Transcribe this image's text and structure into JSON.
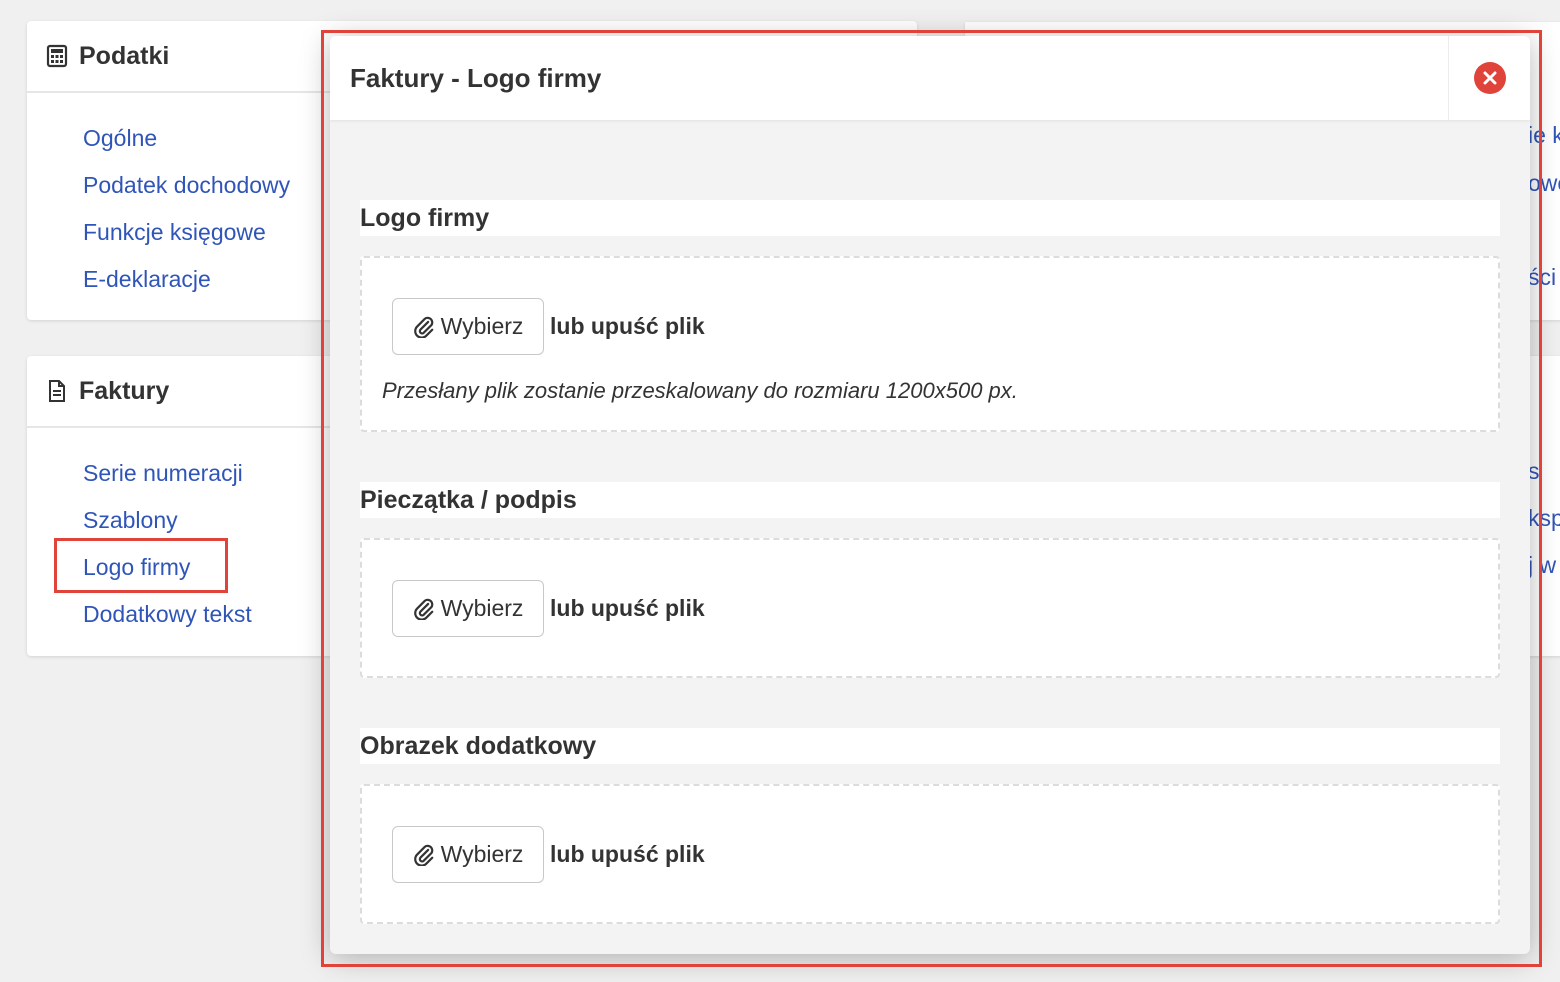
{
  "sidebar": {
    "podatki": {
      "title": "Podatki",
      "icon": "calculator-icon",
      "items": [
        "Ogólne",
        "Podatek dochodowy",
        "Funkcje księgowe",
        "E-deklaracje"
      ]
    },
    "faktury": {
      "title": "Faktury",
      "icon": "document-icon",
      "items": [
        "Serie numeracji",
        "Szablony",
        "Logo firmy",
        "Dodatkowy tekst"
      ]
    }
  },
  "right_fragments": [
    "ie k",
    "owe",
    "ści",
    "s",
    "ksp",
    "j w"
  ],
  "modal": {
    "title": "Faktury - Logo firmy",
    "close_icon": "close-circle-icon",
    "sections": [
      {
        "title": "Logo firmy",
        "choose_label": "Wybierz",
        "drop_text": "lub upuść plik",
        "hint": "Przesłany plik zostanie przeskalowany do rozmiaru 1200x500 px."
      },
      {
        "title": "Pieczątka / podpis",
        "choose_label": "Wybierz",
        "drop_text": "lub upuść plik"
      },
      {
        "title": "Obrazek dodatkowy",
        "choose_label": "Wybierz",
        "drop_text": "lub upuść plik"
      }
    ]
  },
  "colors": {
    "link": "#2f55b8",
    "highlight": "#e0433a",
    "close": "#e0433a"
  }
}
